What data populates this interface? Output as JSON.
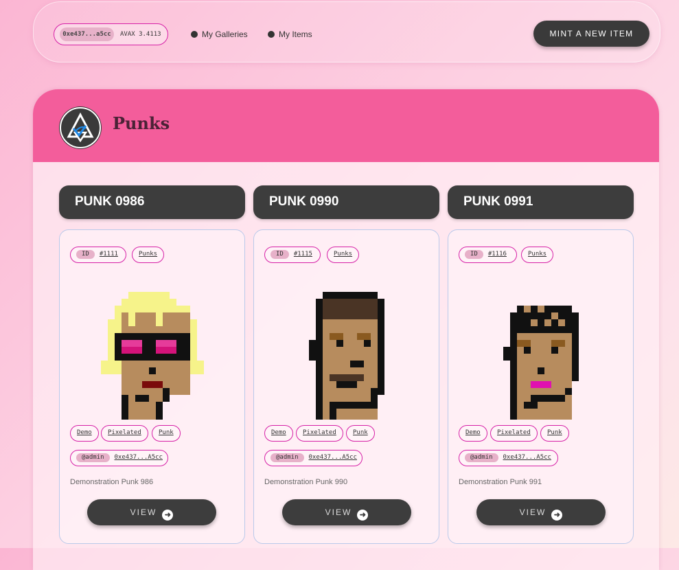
{
  "header": {
    "wallet_address": "0xe437...a5cc",
    "wallet_balance": "AVAX 3.4113",
    "nav": [
      {
        "label": "My Galleries"
      },
      {
        "label": "My Items"
      }
    ],
    "mint_label": "MINT A NEW ITEM"
  },
  "gallery": {
    "title": "Punks",
    "accent_color": "#f35d9b"
  },
  "items": [
    {
      "title": "PUNK 0986",
      "id_label": "ID",
      "id_value": "#1111",
      "collection": "Punks",
      "tags": [
        "Demo",
        "Pixelated",
        "Punk"
      ],
      "owner_label": "@admin",
      "owner_address": "0xe437...A5cc",
      "description": "Demonstration Punk 986",
      "view_label": "VIEW"
    },
    {
      "title": "PUNK 0990",
      "id_label": "ID",
      "id_value": "#1115",
      "collection": "Punks",
      "tags": [
        "Demo",
        "Pixelated",
        "Punk"
      ],
      "owner_label": "@admin",
      "owner_address": "0xe437...A5cc",
      "description": "Demonstration Punk 990",
      "view_label": "VIEW"
    },
    {
      "title": "PUNK 0991",
      "id_label": "ID",
      "id_value": "#1116",
      "collection": "Punks",
      "tags": [
        "Demo",
        "Pixelated",
        "Punk"
      ],
      "owner_label": "@admin",
      "owner_address": "0xe437...A5cc",
      "description": "Demonstration Punk 991",
      "view_label": "VIEW"
    }
  ]
}
